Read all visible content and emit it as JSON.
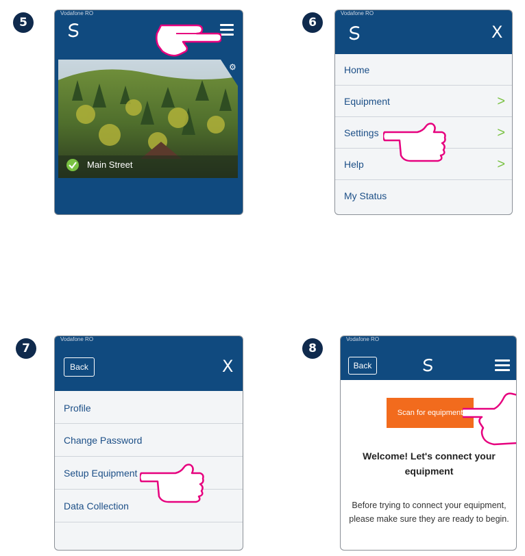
{
  "steps": [
    "5",
    "6",
    "7",
    "8"
  ],
  "carrier": "Vodafone RO",
  "panel5": {
    "location": "Main Street",
    "menu_icon": "hamburger-icon",
    "settings_icon": "gear-icon",
    "status_icon": "check-circle-icon"
  },
  "panel6": {
    "close_label": "X",
    "items": [
      {
        "label": "Home",
        "chevron": ""
      },
      {
        "label": "Equipment",
        "chevron": ">"
      },
      {
        "label": "Settings",
        "chevron": ">"
      },
      {
        "label": "Help",
        "chevron": ">"
      },
      {
        "label": "My Status",
        "chevron": ""
      }
    ]
  },
  "panel7": {
    "back_label": "Back",
    "close_label": "X",
    "items": [
      {
        "label": "Profile"
      },
      {
        "label": "Change Password"
      },
      {
        "label": "Setup Equipment"
      },
      {
        "label": "Data Collection"
      }
    ]
  },
  "panel8": {
    "back_label": "Back",
    "scan_button": "Scan for equipment",
    "heading": "Welcome! Let's connect your equipment",
    "body": "Before trying to connect your equipment, please make sure they are ready to begin."
  },
  "colors": {
    "navy": "#104a7f",
    "link_blue": "#1c4f87",
    "chevron_green": "#79c142",
    "hand_pink": "#e6007e",
    "scan_orange": "#f26b1d",
    "step_badge": "#0f2a4d"
  }
}
